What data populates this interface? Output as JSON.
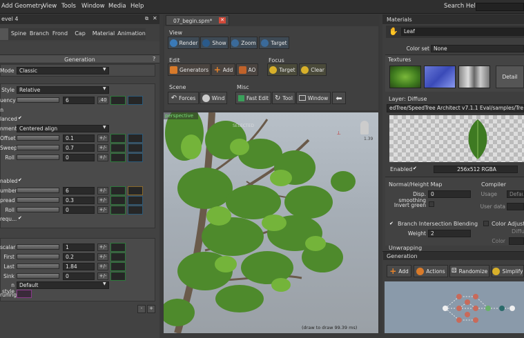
{
  "menu": {
    "items": [
      "Add Geometry",
      "View",
      "Tools",
      "Window",
      "Media",
      "Help"
    ],
    "search_label": "Search Help:"
  },
  "left": {
    "level_title": "evel 4",
    "tabs": [
      "",
      "Spine",
      "Branch",
      "Frond",
      "Cap",
      "Material",
      "Animation"
    ],
    "generation": "Generation",
    "help": "?",
    "mode_label": "Mode",
    "mode_value": "Classic",
    "style_label": "Style",
    "style_value": "Relative",
    "frequency_label": "uency",
    "frequency_value": "6",
    "frequency_btn": ".40",
    "n_label": "n",
    "balanced_label": "lanced",
    "alignment_label": "nment",
    "alignment_value": "Centered align",
    "offset_label": "Offset",
    "offset_value": "0.1",
    "sweep_label": "Sweep",
    "sweep_value": "0.7",
    "roll1_label": "Roll",
    "roll1_value": "0",
    "enabled_label": "nabled",
    "number_label": "umber",
    "number_value": "6",
    "spread_label": "pread",
    "spread_value": "0.3",
    "roll2_label": "Roll",
    "roll2_value": "0",
    "frequ_label": "requ...",
    "scalar_label": "scalar",
    "scalar_value": "1",
    "first_label": "First",
    "first_value": "0.2",
    "last_label": "Last",
    "last_value": "1.84",
    "sink_label": "Sink",
    "sink_value": "0",
    "nstyle_label": "n style",
    "nstyle_value": "Default",
    "pruning_label": "runing",
    "pm": "+/-"
  },
  "center": {
    "doc_tab": "07_begin.spm*",
    "view_label": "View",
    "view_buttons": [
      "Render",
      "Show",
      "Zoom",
      "Target"
    ],
    "edit_label": "Edit",
    "edit_buttons": [
      "Generators",
      "Add",
      "AO"
    ],
    "focus_label": "Focus",
    "focus_buttons": [
      "Target",
      "Clear"
    ],
    "scene_label": "Scene",
    "scene_buttons": [
      "Forces",
      "Wind"
    ],
    "misc_label": "Misc",
    "misc_buttons": [
      "Fast Edit",
      "Tool",
      "Window"
    ],
    "viewport_tag": "perspective",
    "selected_text": "SELECTED",
    "status": "(draw to draw 99.39 ms)",
    "axis_value": "1.39"
  },
  "right": {
    "materials_title": "Materials",
    "leaf_name": "Leaf",
    "colorset_label": "Color set",
    "colorset_value": "None",
    "textures_title": "Textures",
    "detail_btn": "Detail",
    "layer_title": "Layer: Diffuse",
    "layer_path": "edTree/SpeedTree Architect v7.1.1 Eval/samples/Trees/Lea",
    "enabled_label": "Enabled",
    "res_value": "256x512 RGBA",
    "normal_title": "Normal/Height Map",
    "compiler_title": "Compiler",
    "disp_label": "Disp. smoothing",
    "disp_value": "0",
    "usage_label": "Usage",
    "usage_value": "Default",
    "userdata_label": "User data",
    "invert_label": "Invert green",
    "bib_label": "Branch Intersection Blending",
    "coloradj_label": "Color Adjustme",
    "weight_label": "Weight",
    "weight_value": "2",
    "color_label": "Color",
    "diffuse_label": "Diffu",
    "unwrapping": "Unwrapping",
    "generation_title": "Generation",
    "gen_buttons": [
      "Add",
      "Actions",
      "Randomize",
      "Simplify"
    ]
  }
}
